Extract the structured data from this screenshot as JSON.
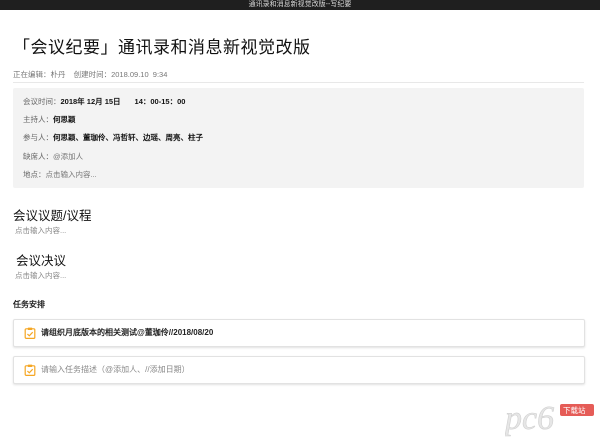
{
  "window": {
    "title": "通讯录和消息新视觉改版--写纪要"
  },
  "doc": {
    "title": "「会议纪要」通讯录和消息新视觉改版",
    "editor_label": "正在编辑：",
    "editor_name": "朴丹",
    "created_label": "创建时间：",
    "created_value": "2018.09.10  9:34"
  },
  "meeting": {
    "time_label": "会议时间：",
    "time_date": "2018年 12月 15日",
    "time_range": "14：00-15：00",
    "host_label": "主持人：",
    "host_value": "何思颖",
    "participants_label": "参与人：",
    "participants_value": "何思颖、董珈伶、冯哲轩、边瑶、周亮、柱子",
    "absent_label": "缺席人：",
    "absent_value": "@添加人",
    "place_label": "地点：",
    "place_value": "点击输入内容..."
  },
  "sections": {
    "agenda": {
      "heading": "会议议题/议程",
      "placeholder": "点击输入内容..."
    },
    "resolution": {
      "heading": "会议决议",
      "placeholder": "点击输入内容..."
    }
  },
  "tasks": {
    "heading": "任务安排",
    "items": [
      {
        "text": "请组织月底版本的相关测试@董珈伶//2018/08/20"
      }
    ],
    "new_placeholder": "请输入任务描述（@添加人、//添加日期）"
  },
  "colors": {
    "accent": "#f5a623",
    "watermark": "#e0403a"
  },
  "icons": {
    "task": "clipboard-check-icon"
  },
  "watermark_text": "pc6 下载站"
}
